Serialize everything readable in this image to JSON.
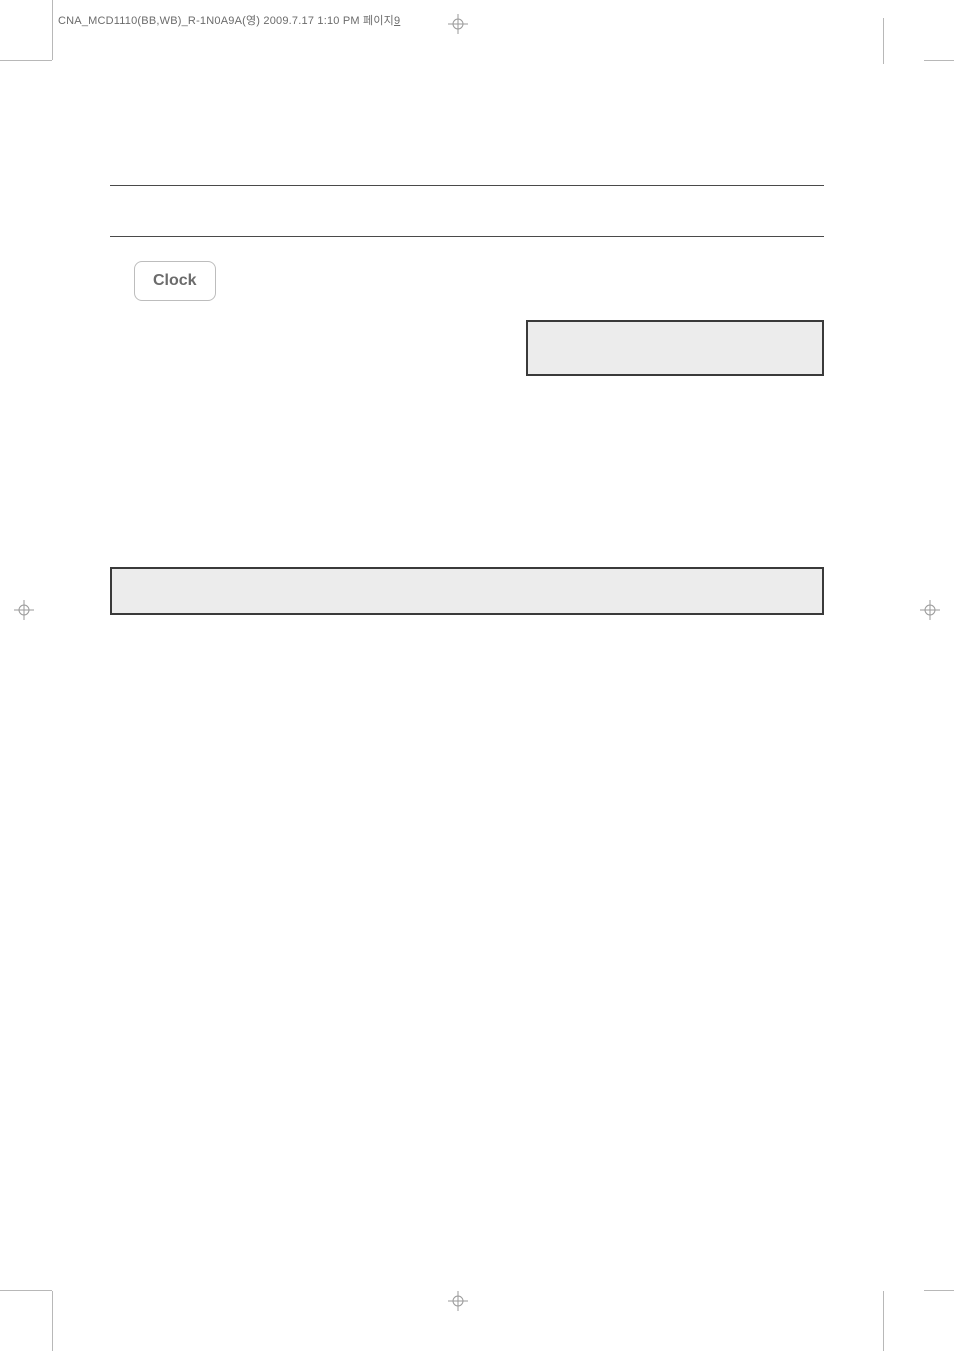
{
  "header": {
    "file_path_prefix": "CNA_MCD1110(BB,WB)_R-1N0A9A(영)  2009.7.17 1:10 PM  페이지",
    "page_number": "9"
  },
  "content": {
    "clock_label": "Clock"
  }
}
